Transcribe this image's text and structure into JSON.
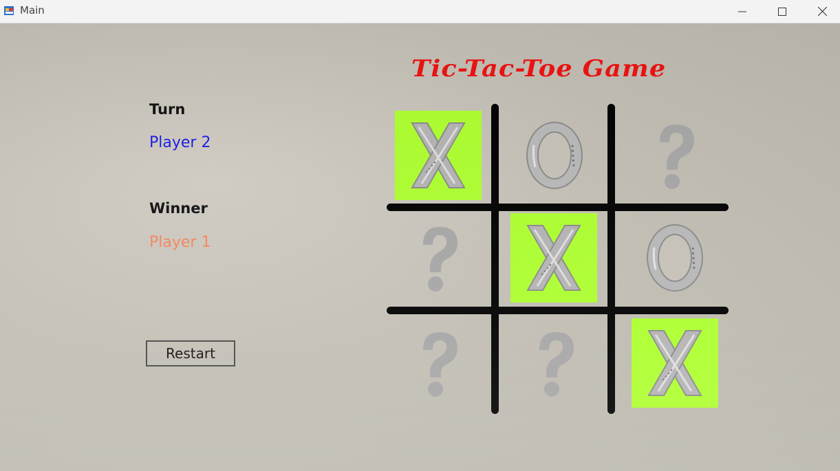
{
  "window": {
    "title": "Main",
    "controls": [
      "minimize-icon",
      "maximize-icon",
      "close-icon"
    ]
  },
  "game": {
    "title": "Tic-Tac-Toe Game",
    "turn_label": "Turn",
    "turn_value": "Player 2",
    "winner_label": "Winner",
    "winner_value": "Player 1",
    "restart_label": "Restart"
  },
  "board": {
    "cells": [
      {
        "row": 1,
        "col": 1,
        "mark": "X",
        "highlighted": true
      },
      {
        "row": 1,
        "col": 2,
        "mark": "O",
        "highlighted": false
      },
      {
        "row": 1,
        "col": 3,
        "mark": "?",
        "highlighted": false
      },
      {
        "row": 2,
        "col": 1,
        "mark": "?",
        "highlighted": false
      },
      {
        "row": 2,
        "col": 2,
        "mark": "X",
        "highlighted": true
      },
      {
        "row": 2,
        "col": 3,
        "mark": "O",
        "highlighted": false
      },
      {
        "row": 3,
        "col": 1,
        "mark": "?",
        "highlighted": false
      },
      {
        "row": 3,
        "col": 2,
        "mark": "?",
        "highlighted": false
      },
      {
        "row": 3,
        "col": 3,
        "mark": "X",
        "highlighted": true
      }
    ]
  },
  "colors": {
    "title": "#ee1111",
    "turn_value": "#1a1ae6",
    "winner_value": "#f5855a",
    "highlight": "#adff2f",
    "grid": "#000000",
    "mark": "#a8a8a8"
  }
}
